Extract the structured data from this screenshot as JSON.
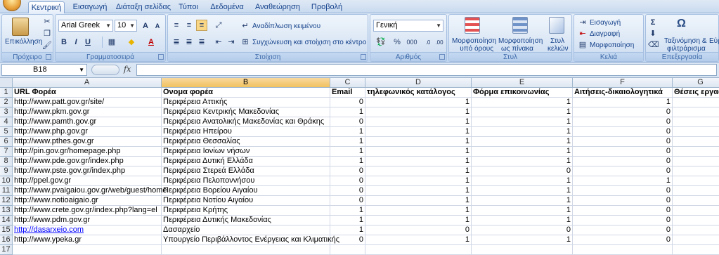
{
  "tabs": [
    "Κεντρική",
    "Εισαγωγή",
    "Διάταξη σελίδας",
    "Τύποι",
    "Δεδομένα",
    "Αναθεώρηση",
    "Προβολή"
  ],
  "ribbon": {
    "clipboard": {
      "paste_label": "Επικόλληση",
      "group_label": "Πρόχειρο"
    },
    "font": {
      "font_name": "Arial Greek",
      "font_size": "10",
      "bold": "B",
      "italic": "I",
      "underline": "U",
      "group_label": "Γραμματοσειρά",
      "grow": "A",
      "shrink": "A"
    },
    "alignment": {
      "wrap_text": "Αναδίπλωση κειμένου",
      "merge_center": "Συγχώνευση και στοίχιση στο κέντρο",
      "group_label": "Στοίχιση"
    },
    "number": {
      "format": "Γενική",
      "percent": "%",
      "thousands": "000",
      "group_label": "Αριθμός"
    },
    "styles": {
      "conditional_line1": "Μορφοποίηση",
      "conditional_line2": "υπό όρους",
      "table_line1": "Μορφοποίηση",
      "table_line2": "ως πίνακα",
      "cell_line1": "Στυλ",
      "cell_line2": "κελιών",
      "group_label": "Στυλ"
    },
    "cells": {
      "insert": "Εισαγωγή",
      "delete": "Διαγραφή",
      "format": "Μορφοποίηση",
      "group_label": "Κελιά"
    },
    "editing": {
      "sort_line1": "Ταξινόμηση &",
      "sort_line2": "φιλτράρισμα",
      "find_line1": "Εύρ",
      "group_label": "Επεξεργασία",
      "sigma": "Σ"
    }
  },
  "formula_bar": {
    "name_box": "B18",
    "fx": "fx",
    "formula": ""
  },
  "columns": [
    "A",
    "B",
    "C",
    "D",
    "E",
    "F",
    "G"
  ],
  "rows": [
    [
      "URL Φορέα",
      "Ονομα φορέα",
      "Email",
      "τηλεφωνικός κατάλογος",
      "Φόρμα επικοινωνίας",
      "Αιτήσεις-δικαιολογητικά",
      "Θέσεις εργασ"
    ],
    [
      "http://www.patt.gov.gr/site/",
      "Περιφέρεια Αττικής",
      "0",
      "1",
      "1",
      "1",
      ""
    ],
    [
      "http://www.pkm.gov.gr",
      "Περιφέρεια Κεντρικής Μακεδονίας",
      "1",
      "1",
      "1",
      "0",
      ""
    ],
    [
      "http://www.pamth.gov.gr",
      "Περιφέρεια Ανατολικής Μακεδονίας και Θράκης",
      "0",
      "1",
      "1",
      "0",
      ""
    ],
    [
      "http://www.php.gov.gr",
      "Περιφέρεια Ηπείρου",
      "1",
      "1",
      "1",
      "0",
      ""
    ],
    [
      "http://www.pthes.gov.gr",
      "Περιφέρεια Θεσσαλίας",
      "1",
      "1",
      "1",
      "0",
      ""
    ],
    [
      "http://pin.gov.gr/homepage.php",
      "Περιφέρεια Ιονίων νήσων",
      "1",
      "1",
      "1",
      "0",
      ""
    ],
    [
      "http://www.pde.gov.gr/index.php",
      "Περιφέρεια Δυτική Ελλάδα",
      "1",
      "1",
      "1",
      "0",
      ""
    ],
    [
      "http://www.pste.gov.gr/index.php",
      "Περιφέρεια Στερεά Ελλάδα",
      "0",
      "1",
      "0",
      "0",
      ""
    ],
    [
      "http://ppel.gov.gr",
      "Περιφέρεια Πελοποννήσου",
      "0",
      "1",
      "1",
      "1",
      ""
    ],
    [
      "http://www.pvaigaiou.gov.gr/web/guest/home",
      "Περιφέρεια Βορείου Αιγαίου",
      "0",
      "1",
      "1",
      "0",
      ""
    ],
    [
      "http://www.notioaigaio.gr",
      "Περιφέρεια Νοτίου Αιγαίου",
      "0",
      "1",
      "1",
      "0",
      ""
    ],
    [
      "http://www.crete.gov.gr/index.php?lang=el",
      "Περιφέρεια Κρήτης",
      "1",
      "1",
      "1",
      "0",
      ""
    ],
    [
      "http://www.pdm.gov.gr",
      "Περιφέρεια Δυτικής Μακεδονίας",
      "1",
      "1",
      "1",
      "0",
      ""
    ],
    [
      "http://dasarxeio.com",
      "Δασαρχείο",
      "1",
      "0",
      "0",
      "0",
      ""
    ],
    [
      "http://www.ypeka.gr",
      "Υπουργείο Περιβάλλοντος Ενέργειας και Κλιματικής",
      "0",
      "1",
      "1",
      "0",
      ""
    ],
    [
      "",
      "",
      "",
      "",
      "",
      "",
      ""
    ]
  ],
  "row_numbers": [
    "1",
    "2",
    "3",
    "4",
    "5",
    "6",
    "7",
    "8",
    "9",
    "10",
    "11",
    "12",
    "13",
    "14",
    "15",
    "16",
    "17"
  ]
}
